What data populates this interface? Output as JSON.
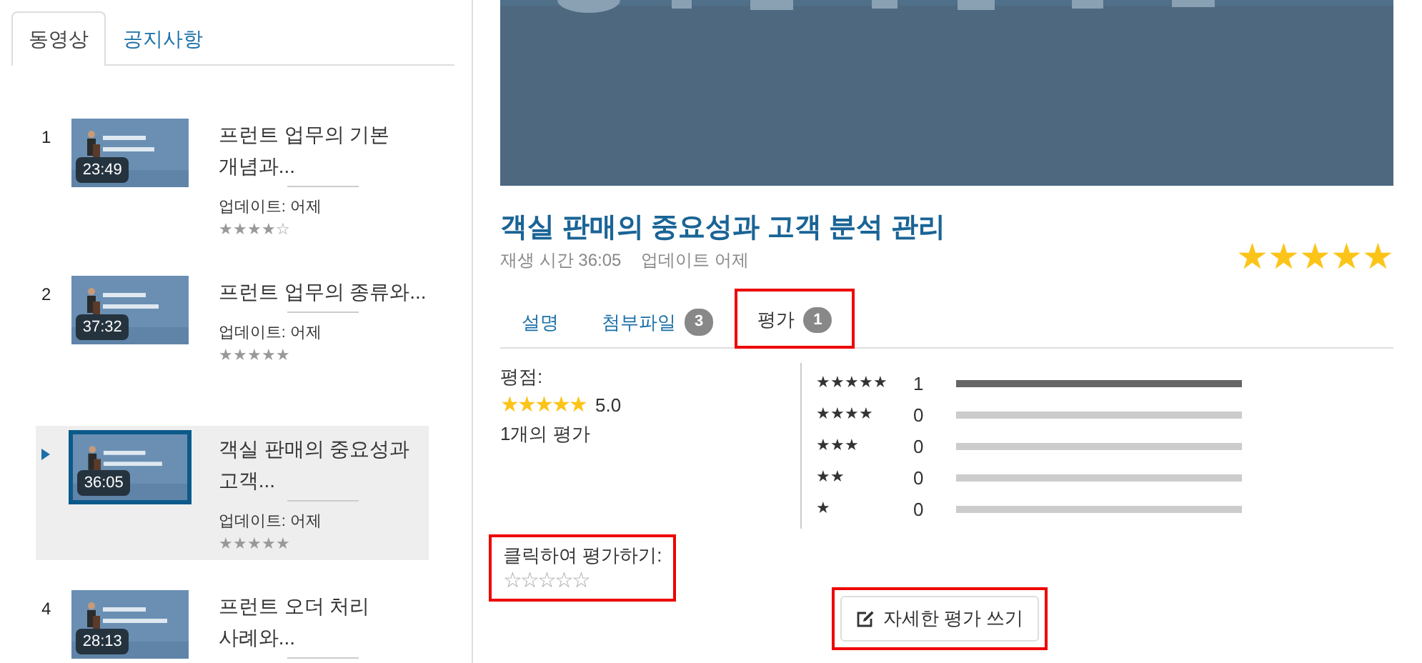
{
  "sidebar": {
    "tabs": [
      {
        "label": "동영상",
        "selected": true
      },
      {
        "label": "공지사항",
        "selected": false
      }
    ],
    "videos": [
      {
        "number": "1",
        "duration": "23:49",
        "title": "프런트 업무의 기본 개념과...",
        "updated": "업데이트: 어제",
        "stars": 4,
        "selected": false
      },
      {
        "number": "2",
        "duration": "37:32",
        "title": "프런트 업무의 종류와...",
        "updated": "업데이트: 어제",
        "stars": 5,
        "selected": false
      },
      {
        "duration": "36:05",
        "title": "객실 판매의 중요성과 고객...",
        "updated": "업데이트: 어제",
        "stars": 5,
        "selected": true
      },
      {
        "number": "4",
        "duration": "28:13",
        "title": "프런트 오더 처리 사례와...",
        "selected": false
      }
    ]
  },
  "detail": {
    "title": "객실 판매의 중요성과 고객 분석 관리",
    "meta": [
      "재생 시간 36:05",
      "업데이트 어제"
    ],
    "stars": 5,
    "tabs": [
      {
        "label": "설명",
        "selected": false,
        "highlighted": false
      },
      {
        "label": "첨부파일",
        "badge": "3",
        "selected": false,
        "highlighted": false
      },
      {
        "label": "평가",
        "badge": "1",
        "selected": true,
        "highlighted": true
      }
    ],
    "rating": {
      "label": "평점:",
      "stars": 5,
      "score": "5.0",
      "count": "1개의 평가",
      "distribution": [
        {
          "label": "★★★★★",
          "count": "1",
          "level": 1
        },
        {
          "label": "★★★★",
          "count": "0",
          "level": 0
        },
        {
          "label": "★★★",
          "count": "0",
          "level": 0
        },
        {
          "label": "★★",
          "count": "0",
          "level": 0
        },
        {
          "label": "★",
          "count": "0",
          "level": 0
        }
      ]
    },
    "rate_prompt": {
      "label": "클릭하여 평가하기:",
      "stars": 0,
      "highlighted": true
    },
    "write_button": {
      "label": "자세한 평가 쓰기",
      "highlighted": true
    }
  }
}
